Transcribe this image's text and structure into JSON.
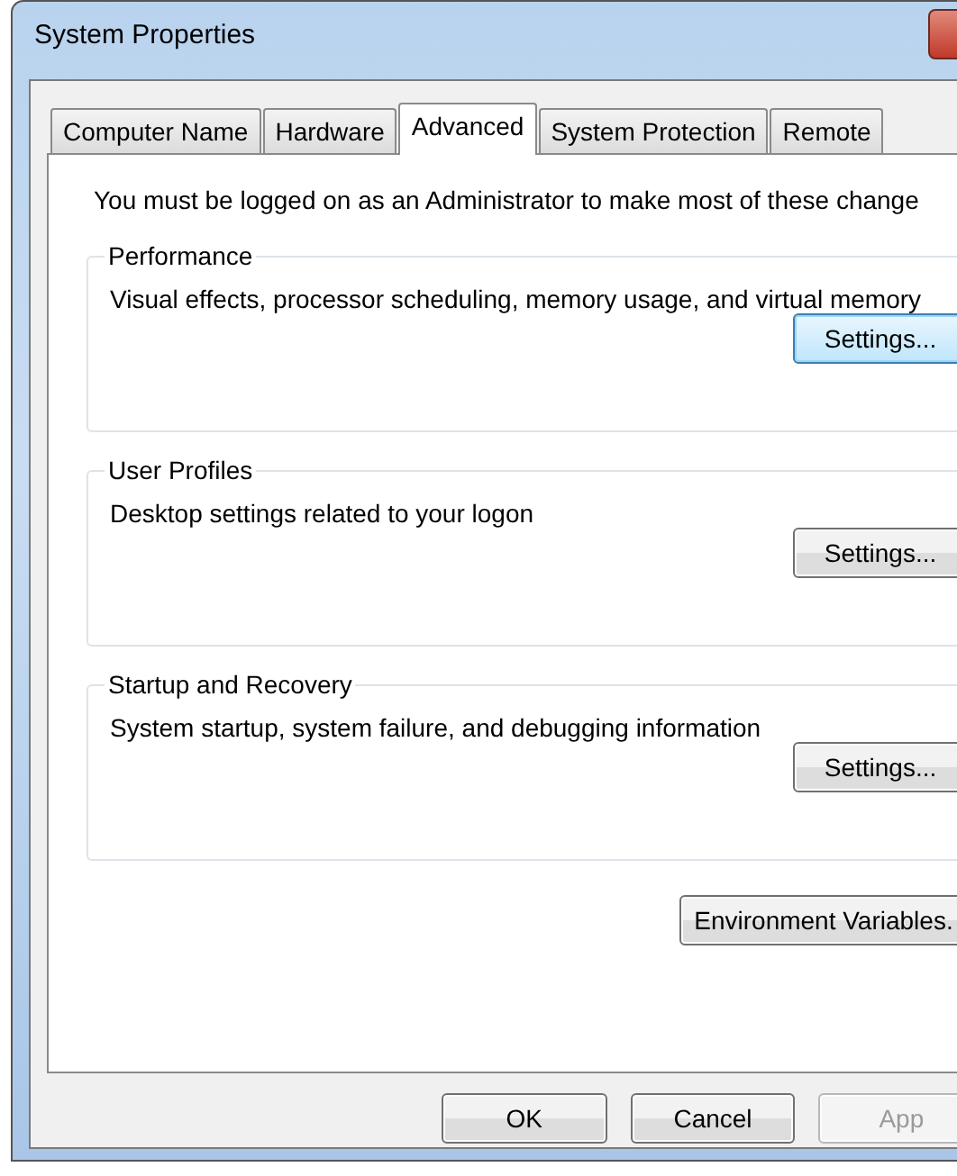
{
  "window": {
    "title": "System Properties"
  },
  "tabs": [
    {
      "label": "Computer Name",
      "selected": false
    },
    {
      "label": "Hardware",
      "selected": false
    },
    {
      "label": "Advanced",
      "selected": true
    },
    {
      "label": "System Protection",
      "selected": false
    },
    {
      "label": "Remote",
      "selected": false
    }
  ],
  "notice": "You must be logged on as an Administrator to make most of these change",
  "groups": [
    {
      "title": "Performance",
      "description": "Visual effects, processor scheduling, memory usage, and virtual memory",
      "button": {
        "label": "Settings...",
        "default": true
      }
    },
    {
      "title": "User Profiles",
      "description": "Desktop settings related to your logon",
      "button": {
        "label": "Settings...",
        "default": false
      }
    },
    {
      "title": "Startup and Recovery",
      "description": "System startup, system failure, and debugging information",
      "button": {
        "label": "Settings...",
        "default": false
      }
    }
  ],
  "environment_button": "Environment Variables.",
  "buttons": [
    {
      "label": "OK",
      "disabled": false
    },
    {
      "label": "Cancel",
      "disabled": false
    },
    {
      "label": "App",
      "disabled": true
    }
  ]
}
